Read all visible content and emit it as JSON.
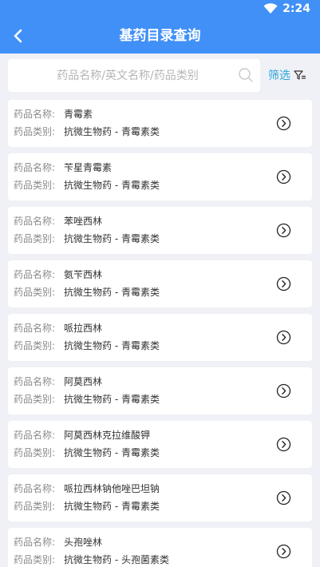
{
  "status_bar": {
    "time": "2:24"
  },
  "header": {
    "title": "基药目录查询",
    "back_icon": "chevron-left-icon"
  },
  "search": {
    "placeholder": "药品名称/英文名称/药品类别",
    "value": ""
  },
  "filter": {
    "label": "筛选",
    "icon": "filter-icon"
  },
  "labels": {
    "name": "药品名称:",
    "category": "药品类别:"
  },
  "colors": {
    "primary": "#4190f7",
    "accent": "#2aa6d9",
    "background": "#f0f1f6"
  },
  "drugs": [
    {
      "name": "青霉素",
      "category": "抗微生物药 - 青霉素类"
    },
    {
      "name": "苄星青霉素",
      "category": "抗微生物药 - 青霉素类"
    },
    {
      "name": "苯唑西林",
      "category": "抗微生物药 - 青霉素类"
    },
    {
      "name": "氨苄西林",
      "category": "抗微生物药 - 青霉素类"
    },
    {
      "name": "哌拉西林",
      "category": "抗微生物药 - 青霉素类"
    },
    {
      "name": "阿莫西林",
      "category": "抗微生物药 - 青霉素类"
    },
    {
      "name": "阿莫西林克拉维酸钾",
      "category": "抗微生物药 - 青霉素类"
    },
    {
      "name": "哌拉西林钠他唑巴坦钠",
      "category": "抗微生物药 - 青霉素类"
    },
    {
      "name": "头孢唑林",
      "category": "抗微生物药 - 头孢菌素类"
    }
  ]
}
